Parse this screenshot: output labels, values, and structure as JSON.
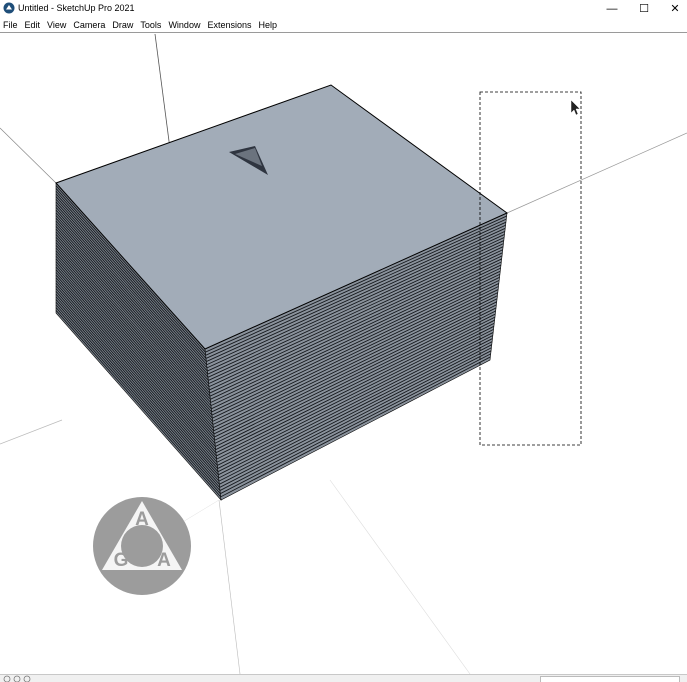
{
  "window": {
    "title": "Untitled - SketchUp Pro 2021",
    "controls": {
      "minimize": "—",
      "maximize": "☐",
      "close": "✕"
    }
  },
  "menu": [
    "File",
    "Edit",
    "View",
    "Camera",
    "Draw",
    "Tools",
    "Window",
    "Extensions",
    "Help"
  ],
  "viewport": {
    "model": "stacked-box",
    "watermark_logo_letters": [
      "A",
      "G",
      "A"
    ],
    "cursor": "arrow-cursor-icon"
  },
  "colors": {
    "face_top": "#a2acb8",
    "edges": "#000000",
    "background": "#ffffff",
    "logo": "#9c9c9c"
  },
  "statusbar": {
    "text": ""
  }
}
